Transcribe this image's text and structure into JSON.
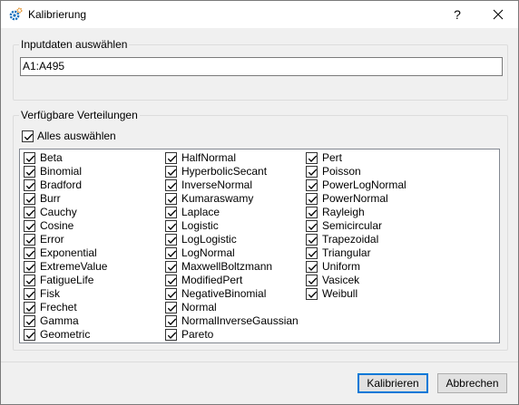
{
  "window": {
    "title": "Kalibrierung",
    "help_label": "?",
    "icon": "gear-icon",
    "accent_color": "#0078d7"
  },
  "input_group": {
    "title": "Inputdaten auswählen",
    "value": "A1:A495"
  },
  "dist_group": {
    "title": "Verfügbare Verteilungen",
    "select_all": {
      "label": "Alles auswählen",
      "checked": true
    }
  },
  "distributions": {
    "col1": [
      {
        "label": "Beta",
        "checked": true
      },
      {
        "label": "Binomial",
        "checked": true
      },
      {
        "label": "Bradford",
        "checked": true
      },
      {
        "label": "Burr",
        "checked": true
      },
      {
        "label": "Cauchy",
        "checked": true
      },
      {
        "label": "Cosine",
        "checked": true
      },
      {
        "label": "Error",
        "checked": true
      },
      {
        "label": "Exponential",
        "checked": true
      },
      {
        "label": "ExtremeValue",
        "checked": true
      },
      {
        "label": "FatigueLife",
        "checked": true
      },
      {
        "label": "Fisk",
        "checked": true
      },
      {
        "label": "Frechet",
        "checked": true
      },
      {
        "label": "Gamma",
        "checked": true
      },
      {
        "label": "Geometric",
        "checked": true
      }
    ],
    "col2": [
      {
        "label": "HalfNormal",
        "checked": true
      },
      {
        "label": "HyperbolicSecant",
        "checked": true
      },
      {
        "label": "InverseNormal",
        "checked": true
      },
      {
        "label": "Kumaraswamy",
        "checked": true
      },
      {
        "label": "Laplace",
        "checked": true
      },
      {
        "label": "Logistic",
        "checked": true
      },
      {
        "label": "LogLogistic",
        "checked": true
      },
      {
        "label": "LogNormal",
        "checked": true
      },
      {
        "label": "MaxwellBoltzmann",
        "checked": true
      },
      {
        "label": "ModifiedPert",
        "checked": true
      },
      {
        "label": "NegativeBinomial",
        "checked": true
      },
      {
        "label": "Normal",
        "checked": true
      },
      {
        "label": "NormalInverseGaussian",
        "checked": true
      },
      {
        "label": "Pareto",
        "checked": true
      }
    ],
    "col3": [
      {
        "label": "Pert",
        "checked": true
      },
      {
        "label": "Poisson",
        "checked": true
      },
      {
        "label": "PowerLogNormal",
        "checked": true
      },
      {
        "label": "PowerNormal",
        "checked": true
      },
      {
        "label": "Rayleigh",
        "checked": true
      },
      {
        "label": "Semicircular",
        "checked": true
      },
      {
        "label": "Trapezoidal",
        "checked": true
      },
      {
        "label": "Triangular",
        "checked": true
      },
      {
        "label": "Uniform",
        "checked": true
      },
      {
        "label": "Vasicek",
        "checked": true
      },
      {
        "label": "Weibull",
        "checked": true
      }
    ]
  },
  "buttons": {
    "calibrate": "Kalibrieren",
    "cancel": "Abbrechen"
  }
}
